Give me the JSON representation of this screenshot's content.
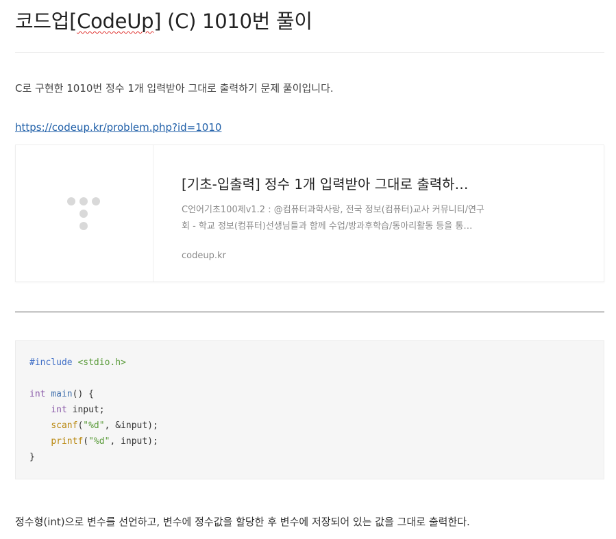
{
  "post": {
    "title_prefix": "코드업[",
    "title_spell": "CodeUp",
    "title_suffix": "] (C) 1010번 풀이",
    "intro": "C로 구현한 1010번 정수 1개 입력받아 그대로 출력하기 문제 풀이입니다.",
    "link_text": "https://codeup.kr/problem.php?id=1010",
    "closing": "정수형(int)으로 변수를 선언하고, 변수에 정수값을 할당한 후 변수에 저장되어 있는 값을 그대로 출력한다."
  },
  "og_card": {
    "title": "[기초-입출력] 정수 1개 입력받아 그대로 출력하…",
    "desc_line1": "C언어기초100제v1.2 : @컴퓨터과학사랑, 전국 정보(컴퓨터)교사 커뮤니티/연구",
    "desc_line2": "회 - 학교 정보(컴퓨터)선생님들과 함께 수업/방과후학습/동아리활동 등을 통…",
    "host": "codeup.kr",
    "thumb_icon": "placeholder-dots-icon"
  },
  "code": {
    "l1_pp": "#include",
    "l1_sp": " ",
    "l1_str": "<stdio.h>",
    "l3_kw": "int",
    "l3_fn": "main",
    "l3_rest": "() {",
    "l4_indent": "    ",
    "l4_kw": "int",
    "l4_rest": " input;",
    "l5_indent": "    ",
    "l5_fn": "scanf",
    "l5_open": "(",
    "l5_str": "\"%d\"",
    "l5_rest": ", &input);",
    "l6_indent": "    ",
    "l6_fn": "printf",
    "l6_open": "(",
    "l6_str": "\"%d\"",
    "l6_rest": ", input);",
    "l7": "}"
  },
  "colors": {
    "link": "#1f5fa8",
    "keyword": "#8959a8",
    "preprocessor": "#3f6ec6",
    "string": "#5a9b3a",
    "function": "#b8860b"
  }
}
